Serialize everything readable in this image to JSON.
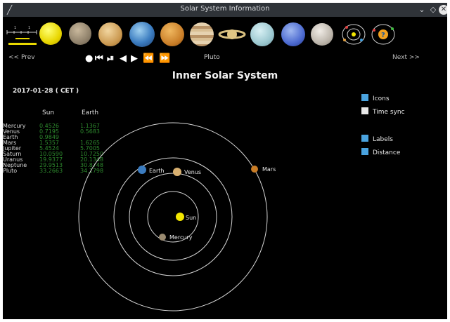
{
  "window": {
    "title": "Solar System Information"
  },
  "nav": {
    "prev": "<< Prev",
    "next": "Next >>",
    "current": "Pluto"
  },
  "controls": [
    "●",
    "⏮",
    "⏯",
    "◀",
    "▶",
    "⏪",
    "⏩"
  ],
  "scale": {
    "ticks": [
      "1",
      "1"
    ]
  },
  "heading": "Inner Solar System",
  "datetime": "2017-01-28   ( CET )",
  "table": {
    "col_sun": "Sun",
    "col_earth": "Earth",
    "rows": [
      {
        "name": "Mercury",
        "sun": "0.4526",
        "earth": "1.1367"
      },
      {
        "name": "Venus",
        "sun": "0.7195",
        "earth": "0.5683"
      },
      {
        "name": "Earth",
        "sun": "0.9849",
        "earth": ""
      },
      {
        "name": "Mars",
        "sun": "1.5357",
        "earth": "1.6265"
      },
      {
        "name": "Jupiter",
        "sun": "5.4524",
        "earth": "5.7005"
      },
      {
        "name": "Saturn",
        "sun": "10.0590",
        "earth": "10.7250"
      },
      {
        "name": "Uranus",
        "sun": "19.9377",
        "earth": "20.1348"
      },
      {
        "name": "Neptune",
        "sun": "29.9513",
        "earth": "30.8748"
      },
      {
        "name": "Pluto",
        "sun": "33.2663",
        "earth": "34.1798"
      }
    ]
  },
  "options": [
    {
      "label": "Icons",
      "checked": true
    },
    {
      "label": "Time sync",
      "checked": false
    },
    {
      "label": "Labels",
      "checked": true
    },
    {
      "label": "Distance",
      "checked": true
    }
  ],
  "map_labels": {
    "sun": "Sun",
    "mercury": "Mercury",
    "venus": "Venus",
    "earth": "Earth",
    "mars": "Mars"
  },
  "colors": {
    "checked": "#4aa3df",
    "unchecked": "#e8e8e8",
    "values": "#2e8b2e",
    "titlebar": "#2f3338",
    "sun": "#f2e600"
  },
  "icons": [
    "app-icon",
    "minimize-icon",
    "maximize-icon",
    "close-icon"
  ]
}
